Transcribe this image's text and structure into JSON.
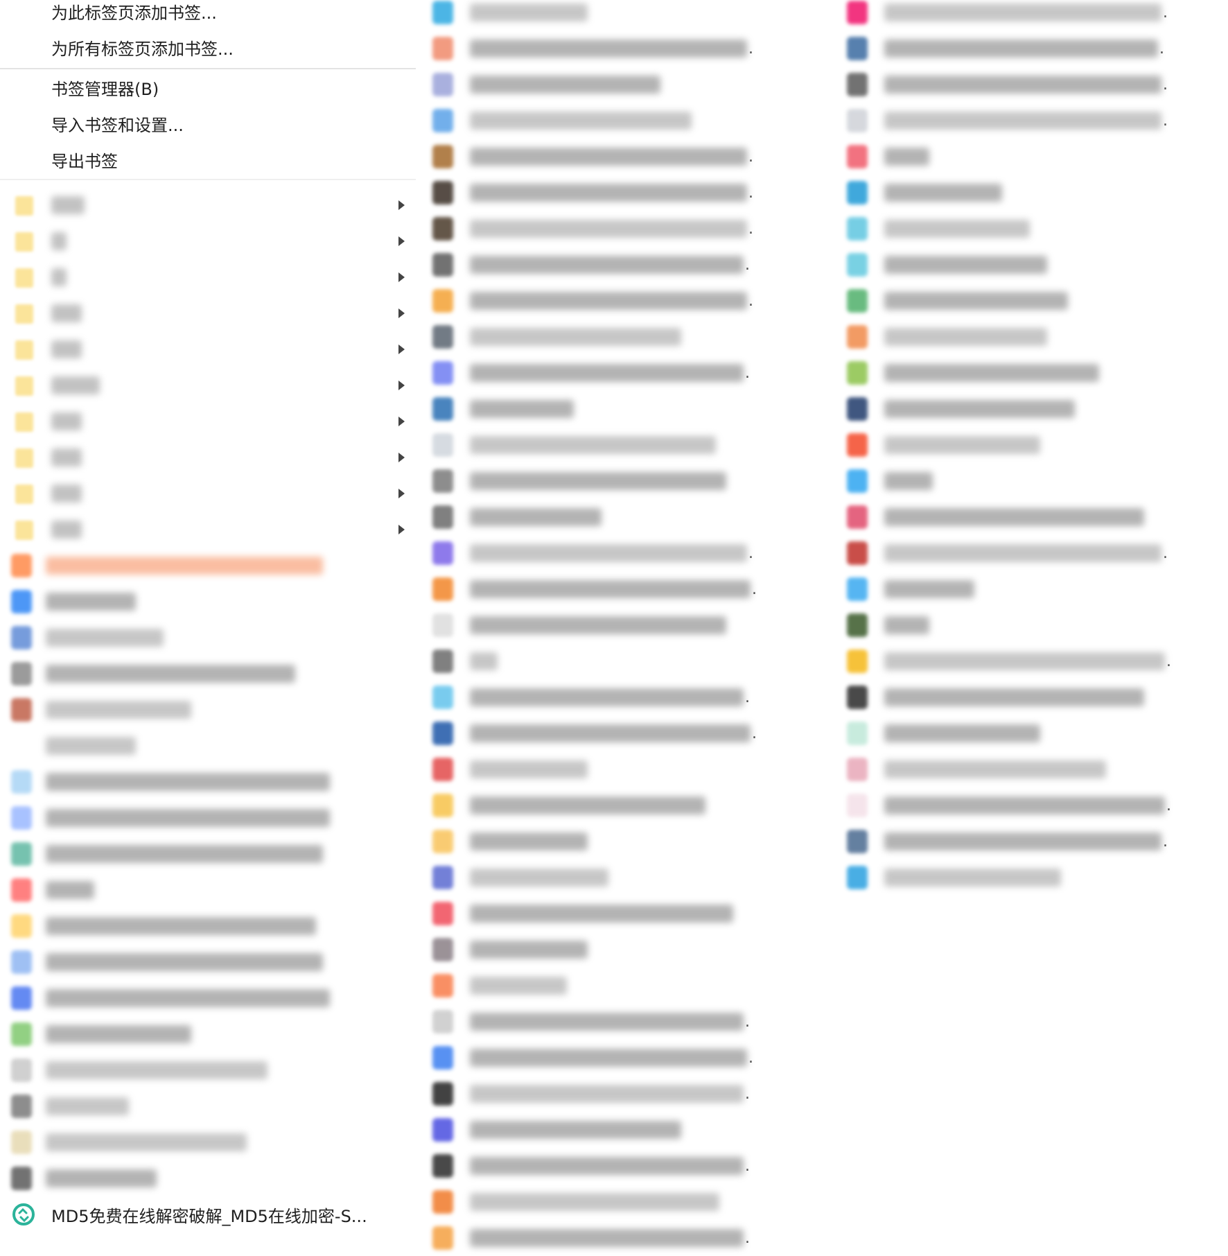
{
  "menu": {
    "commands_top": [
      "为此标签页添加书签...",
      "为所有标签页添加书签..."
    ],
    "commands_manage": [
      "书签管理器(B)",
      "导入书签和设置...",
      "导出书签"
    ]
  },
  "folders_count": 10,
  "bookmark_md5": {
    "label": "MD5免费在线解密破解_MD5在线加密-S...",
    "icon": "md5-site-icon",
    "icon_color": "#2bb39a"
  },
  "colors": {
    "folder": "#fbe49a",
    "separator": "#e3e3e3",
    "submenu_caret": "#444444"
  },
  "col1_icons": [
    "#ff8a4a",
    "#2f86f5",
    "#5f8bd6",
    "#8a8a8a",
    "#c0614a",
    "#ffffff",
    "#a9d4f5",
    "#9ab8ff",
    "#5fb8a2",
    "#ff6b6b",
    "#ffd36b",
    "#8fb6f2",
    "#4a76f0",
    "#7fc86e",
    "#c8c8c8",
    "#7a7a7a",
    "#e6d9b0",
    "#5a5a5a"
  ],
  "col1_bars": [
    [
      400,
      "orange"
    ],
    [
      130,
      "dark"
    ],
    [
      170,
      "mid"
    ],
    [
      360,
      "dark"
    ],
    [
      210,
      "mid"
    ],
    [
      130,
      "mid"
    ],
    [
      410,
      "dark"
    ],
    [
      410,
      "dark"
    ],
    [
      400,
      "dark"
    ],
    [
      70,
      "dark"
    ],
    [
      390,
      "dark"
    ],
    [
      400,
      "dark"
    ],
    [
      410,
      "dark"
    ],
    [
      210,
      "dark"
    ],
    [
      320,
      "mid"
    ],
    [
      120,
      "mid"
    ],
    [
      290,
      "mid"
    ],
    [
      160,
      "dark"
    ]
  ],
  "col2_icons": [
    "#2da9e1",
    "#f08a6b",
    "#9ba3d9",
    "#5aa2e8",
    "#a46a2c",
    "#3a2f26",
    "#4a3a2a",
    "#5a5a5a",
    "#f4a234",
    "#5a6470",
    "#6f7df2",
    "#2a6fb3",
    "#cfd5dc",
    "#7a7a7a",
    "#6a6a6a",
    "#7b63e8",
    "#f2862a",
    "#dcdcdc",
    "#6a6a6a",
    "#62c3ec",
    "#1e57a8",
    "#e24b4b",
    "#f7c34a",
    "#f9c35a",
    "#5b6ad1",
    "#f04c5a",
    "#8a7f86",
    "#f97c4a",
    "#c9c9c9",
    "#3b7ef0",
    "#222222",
    "#4a4ee0",
    "#2a2a2a",
    "#f07a2a",
    "#f5a041"
  ],
  "col2_bars": [
    170,
    400,
    275,
    320,
    400,
    400,
    400,
    395,
    400,
    305,
    395,
    150,
    355,
    370,
    190,
    400,
    405,
    370,
    40,
    395,
    405,
    170,
    340,
    170,
    200,
    380,
    170,
    140,
    395,
    400,
    395,
    305,
    395,
    360,
    395
  ],
  "col3_icons": [
    "#f0126a",
    "#3a6aa0",
    "#5a5a5a",
    "#cfd2d8",
    "#f05a6a",
    "#1f9ad6",
    "#5fc6e0",
    "#62c9df",
    "#4fb06a",
    "#f08a4a",
    "#8bc24a",
    "#1f3a6a",
    "#f44a2a",
    "#2fa5f0",
    "#e04a6a",
    "#c0302a",
    "#39a9f0",
    "#3a5a2a",
    "#f5b818",
    "#2a2a2a",
    "#bfe8d8",
    "#e8a8b8",
    "#f4e0e8",
    "#4a6a90",
    "#2aa0e0"
  ],
  "col3_bars": [
    400,
    395,
    400,
    400,
    65,
    170,
    210,
    235,
    265,
    235,
    310,
    275,
    225,
    70,
    375,
    400,
    130,
    65,
    405,
    375,
    225,
    320,
    405,
    400,
    255
  ]
}
